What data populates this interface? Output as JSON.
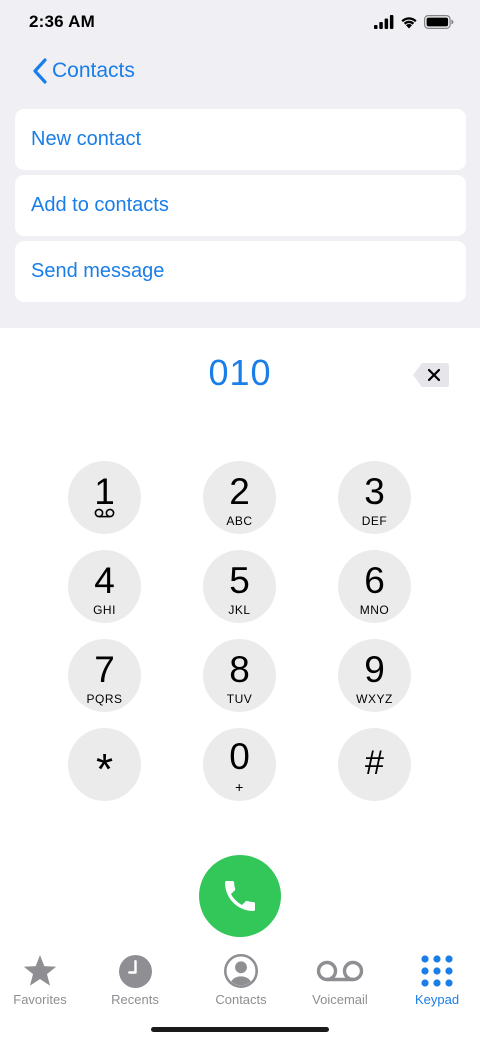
{
  "status_bar": {
    "time": "2:36 AM"
  },
  "nav": {
    "back_label": "Contacts"
  },
  "menu": {
    "items": [
      {
        "label": "New contact"
      },
      {
        "label": "Add to contacts"
      },
      {
        "label": "Send message"
      }
    ]
  },
  "dialer": {
    "entered_number": "010",
    "keys": [
      {
        "digit": "1",
        "letters": ""
      },
      {
        "digit": "2",
        "letters": "ABC"
      },
      {
        "digit": "3",
        "letters": "DEF"
      },
      {
        "digit": "4",
        "letters": "GHI"
      },
      {
        "digit": "5",
        "letters": "JKL"
      },
      {
        "digit": "6",
        "letters": "MNO"
      },
      {
        "digit": "7",
        "letters": "PQRS"
      },
      {
        "digit": "8",
        "letters": "TUV"
      },
      {
        "digit": "9",
        "letters": "WXYZ"
      },
      {
        "digit": "*",
        "letters": ""
      },
      {
        "digit": "0",
        "letters": "+"
      },
      {
        "digit": "#",
        "letters": ""
      }
    ]
  },
  "tab_bar": {
    "tabs": [
      {
        "label": "Favorites",
        "icon": "star-icon"
      },
      {
        "label": "Recents",
        "icon": "clock-icon"
      },
      {
        "label": "Contacts",
        "icon": "person-circle-icon"
      },
      {
        "label": "Voicemail",
        "icon": "voicemail-icon"
      },
      {
        "label": "Keypad",
        "icon": "keypad-grid-icon"
      }
    ],
    "active_tab": "Keypad"
  },
  "colors": {
    "accent": "#1a7ee8",
    "call_green": "#33c659",
    "key_background": "#ebebeb",
    "top_background": "#efeff4",
    "inactive_tab": "#8e8e93"
  }
}
